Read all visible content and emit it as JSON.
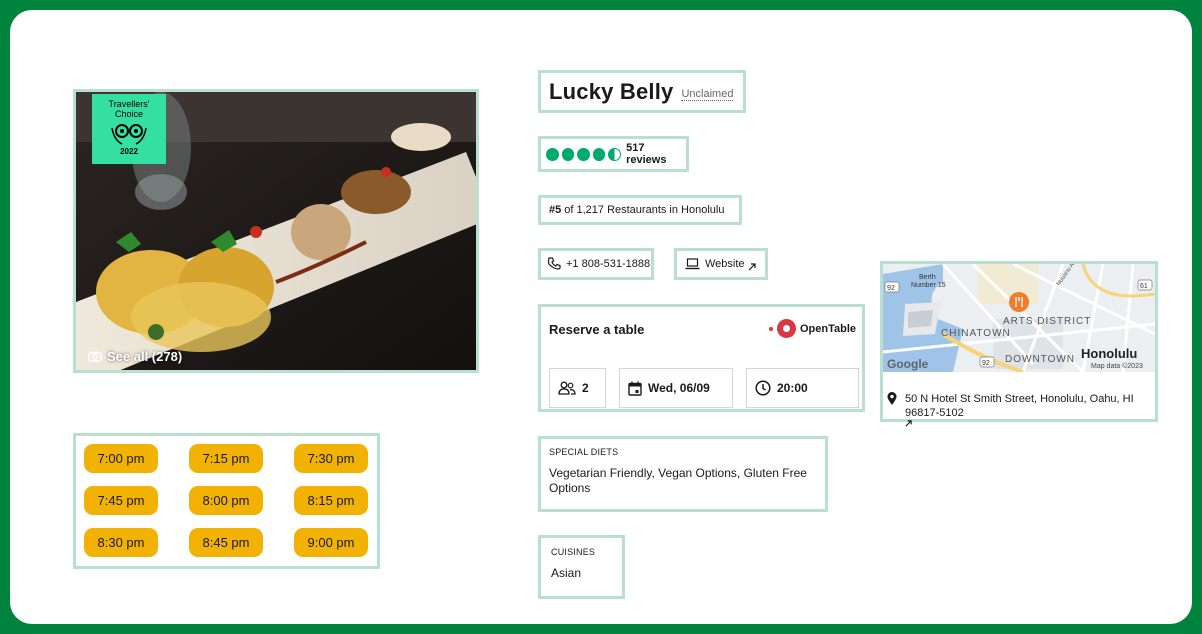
{
  "photo": {
    "badge": {
      "line1": "Travellers'",
      "line2": "Choice",
      "year": "2022"
    },
    "see_all": "See all (278)"
  },
  "times": [
    "7:00 pm",
    "7:15 pm",
    "7:30 pm",
    "7:45 pm",
    "8:00 pm",
    "8:15 pm",
    "8:30 pm",
    "8:45 pm",
    "9:00 pm"
  ],
  "restaurant": {
    "name": "Lucky Belly",
    "claim_status": "Unclaimed",
    "rating": 4.5,
    "reviews": "517 reviews",
    "rank_num": "#5",
    "rank_text": "of 1,217 Restaurants in Honolulu",
    "phone": "+1 808-531-1888",
    "website": "Website"
  },
  "reserve": {
    "title": "Reserve a table",
    "brand": "OpenTable",
    "party": "2",
    "date": "Wed, 06/09",
    "time": "20:00"
  },
  "special_diets": {
    "label": "SPECIAL DIETS",
    "value": "Vegetarian Friendly, Vegan Options, Gluten Free Options"
  },
  "cuisines": {
    "label": "CUISINES",
    "value": "Asian"
  },
  "map": {
    "labels": {
      "berth": "Berth",
      "number": "Number 15",
      "arts": "ARTS DISTRICT",
      "chinatown": "CHINATOWN",
      "downtown": "DOWNTOWN",
      "honolulu": "Honolulu",
      "google": "Google",
      "mapdata": "Map data ©2023",
      "nuuanu": "Nuuanu Ave",
      "r92a": "92",
      "r92b": "92",
      "r61": "61"
    },
    "address_line1": "50 N Hotel St Smith Street, Honolulu, Oahu, HI",
    "address_line2": "96817-5102"
  },
  "colors": {
    "frame": "#00843d",
    "box_border": "#b9dfd0",
    "slot": "#f2b203",
    "rating": "#00aa6c",
    "badge": "#34e0a1",
    "opentable": "#da3743"
  }
}
